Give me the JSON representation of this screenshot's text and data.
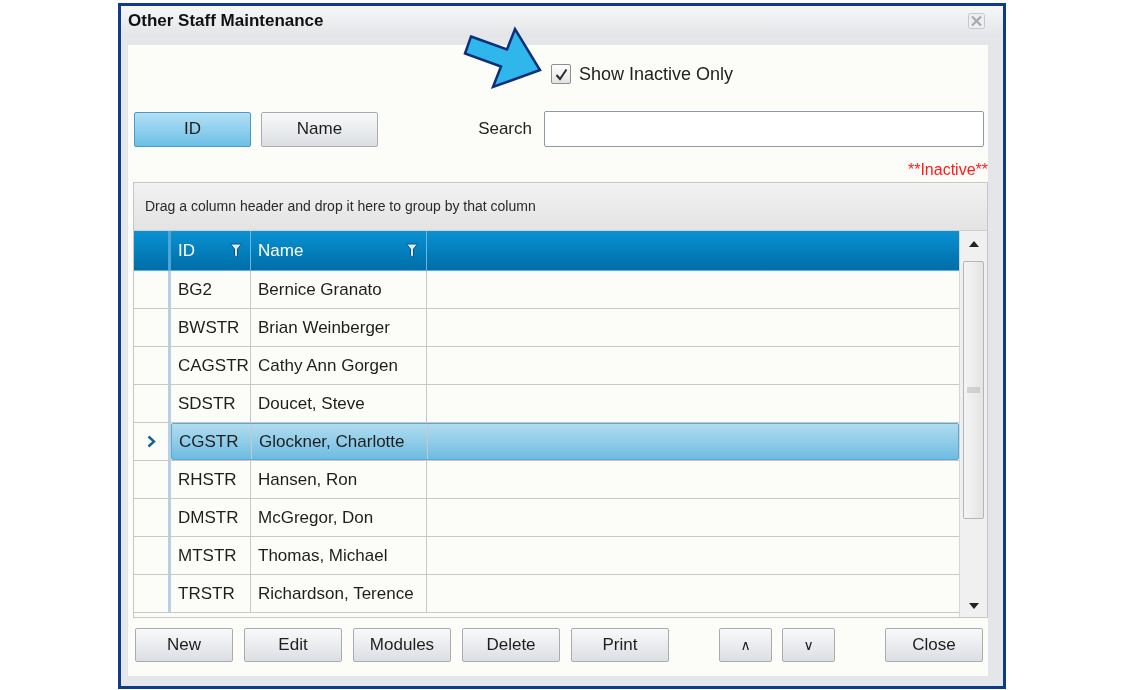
{
  "window": {
    "title": "Other Staff Maintenance"
  },
  "filter": {
    "label": "Show Inactive Only",
    "checked": true
  },
  "sort_buttons": [
    {
      "label": "ID",
      "selected": true
    },
    {
      "label": "Name",
      "selected": false
    }
  ],
  "search": {
    "label": "Search"
  },
  "legend": "**Inactive**",
  "grid": {
    "group_hint": "Drag a column header and drop it here to group by that column",
    "columns": [
      {
        "label": "ID"
      },
      {
        "label": "Name"
      }
    ],
    "rows": [
      {
        "cells": [
          "BG2",
          "Bernice Granato"
        ],
        "selected": false
      },
      {
        "cells": [
          "BWSTR",
          "Brian Weinberger"
        ],
        "selected": false
      },
      {
        "cells": [
          "CAGSTR",
          "Cathy Ann Gorgen"
        ],
        "selected": false
      },
      {
        "cells": [
          "SDSTR",
          "Doucet, Steve"
        ],
        "selected": false
      },
      {
        "cells": [
          "CGSTR",
          "Glockner, Charlotte"
        ],
        "selected": true
      },
      {
        "cells": [
          "RHSTR",
          "Hansen, Ron"
        ],
        "selected": false
      },
      {
        "cells": [
          "DMSTR",
          "McGregor, Don"
        ],
        "selected": false
      },
      {
        "cells": [
          "MTSTR",
          "Thomas, Michael"
        ],
        "selected": false
      },
      {
        "cells": [
          "TRSTR",
          "Richardson, Terence"
        ],
        "selected": false
      }
    ]
  },
  "actions": [
    "New",
    "Edit",
    "Modules",
    "Delete",
    "Print"
  ],
  "move_buttons": [
    "∧",
    "∨"
  ],
  "close_button": "Close"
}
